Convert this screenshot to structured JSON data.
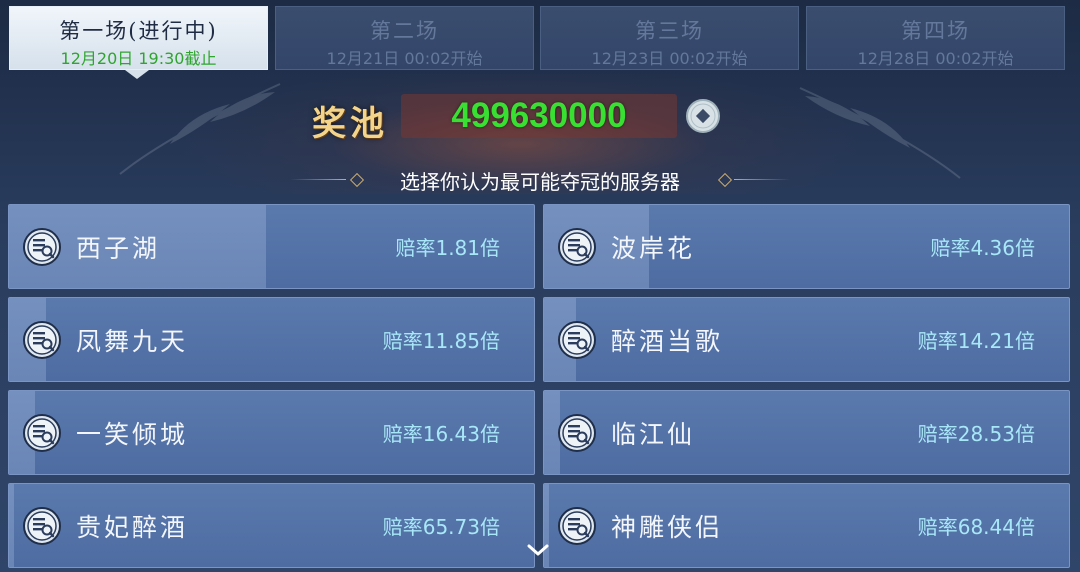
{
  "tabs": [
    {
      "title": "第一场(进行中)",
      "subtitle": "12月20日 19:30截止",
      "active": true
    },
    {
      "title": "第二场",
      "subtitle": "12月21日 00:02开始",
      "active": false
    },
    {
      "title": "第三场",
      "subtitle": "12月23日 00:02开始",
      "active": false
    },
    {
      "title": "第四场",
      "subtitle": "12月28日 00:02开始",
      "active": false
    }
  ],
  "prize_pool": {
    "label": "奖池",
    "amount": "499630000",
    "currency_icon": "coin-icon"
  },
  "hint": "选择你认为最可能夺冠的服务器",
  "servers": [
    {
      "name": "西子湖",
      "odds": "赔率1.81倍",
      "vote_share": 0.49,
      "icon": "server-emblem-icon"
    },
    {
      "name": "波岸花",
      "odds": "赔率4.36倍",
      "vote_share": 0.2,
      "icon": "server-emblem-icon"
    },
    {
      "name": "凤舞九天",
      "odds": "赔率11.85倍",
      "vote_share": 0.07,
      "icon": "server-emblem-icon"
    },
    {
      "name": "醉酒当歌",
      "odds": "赔率14.21倍",
      "vote_share": 0.06,
      "icon": "server-emblem-icon"
    },
    {
      "name": "一笑倾城",
      "odds": "赔率16.43倍",
      "vote_share": 0.05,
      "icon": "server-emblem-icon"
    },
    {
      "name": "临江仙",
      "odds": "赔率28.53倍",
      "vote_share": 0.03,
      "icon": "server-emblem-icon"
    },
    {
      "name": "贵妃醉酒",
      "odds": "赔率65.73倍",
      "vote_share": 0.01,
      "icon": "server-emblem-icon"
    },
    {
      "name": "神雕侠侣",
      "odds": "赔率68.44倍",
      "vote_share": 0.01,
      "icon": "server-emblem-icon"
    }
  ],
  "colors": {
    "active_tab_subtitle": "#2fa52f",
    "pool_amount": "#38e032",
    "odds_text": "#a8e7f7",
    "pool_label": "#f3d48a"
  },
  "scroll_icon": "chevron-down-icon"
}
